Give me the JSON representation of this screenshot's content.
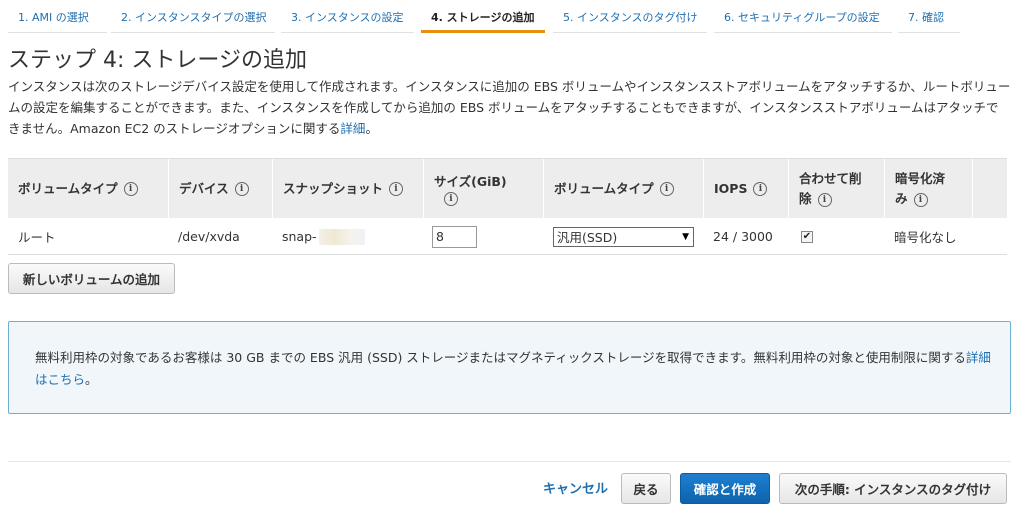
{
  "steps": [
    {
      "label": "1. AMI の選択"
    },
    {
      "label": "2. インスタンスタイプの選択"
    },
    {
      "label": "3. インスタンスの設定"
    },
    {
      "label": "4. ストレージの追加"
    },
    {
      "label": "5. インスタンスのタグ付け"
    },
    {
      "label": "6. セキュリティグループの設定"
    },
    {
      "label": "7. 確認"
    }
  ],
  "page": {
    "title": "ステップ 4: ストレージの追加",
    "description_1": "インスタンスは次のストレージデバイス設定を使用して作成されます。インスタンスに追加の EBS ボリュームやインスタンスストアボリュームをアタッチするか、ルートボリュームの設定を編集することができます。また、インスタンスを作成してから追加の EBS ボリュームをアタッチすることもできますが、インスタンスストアボリュームはアタッチできません。Amazon EC2 のストレージオプションに関する",
    "description_link": "詳細",
    "description_end": "。"
  },
  "table": {
    "headers": {
      "volume_type": "ボリュームタイプ",
      "device": "デバイス",
      "snapshot": "スナップショット",
      "size_1": "サイズ(GiB)",
      "ebs_type": "ボリュームタイプ",
      "iops": "IOPS",
      "delete_1": "合わせて削",
      "delete_2": "除",
      "encrypted_1": "暗号化済",
      "encrypted_2": "み"
    },
    "rows": [
      {
        "volume_type": "ルート",
        "device": "/dev/xvda",
        "snapshot": "snap-",
        "size": "8",
        "ebs_type": "汎用(SSD)",
        "iops": "24 / 3000",
        "delete_on_termination": "✔",
        "encrypted": "暗号化なし"
      }
    ]
  },
  "add_volume_button": "新しいボリュームの追加",
  "notice": {
    "text": "無料利用枠の対象であるお客様は 30 GB までの EBS 汎用 (SSD) ストレージまたはマグネティックストレージを取得できます。無料利用枠の対象と使用制限に関する",
    "link": "詳細はこちら",
    "end": "。"
  },
  "footer": {
    "cancel": "キャンセル",
    "back": "戻る",
    "review_launch": "確認と作成",
    "next": "次の手順: インスタンスのタグ付け"
  },
  "info_glyph": "i",
  "colors": {
    "link": "#1f6fb0",
    "active_tab": "#e88f10",
    "primary_button": "#1473c5"
  }
}
